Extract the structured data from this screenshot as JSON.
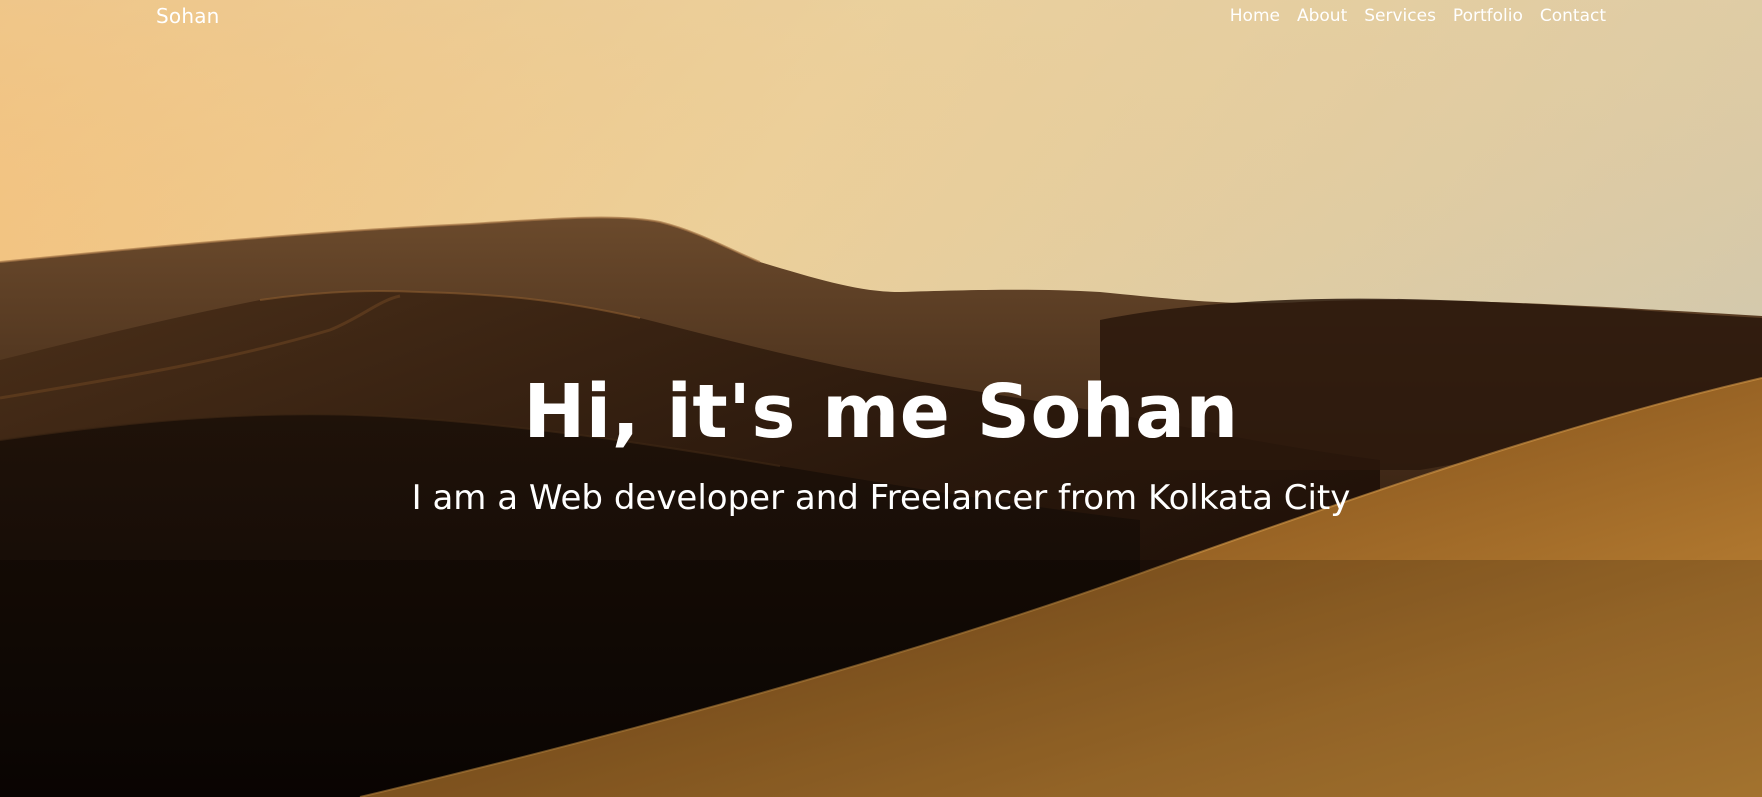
{
  "navbar": {
    "brand": "Sohan",
    "links": [
      {
        "label": "Home"
      },
      {
        "label": "About"
      },
      {
        "label": "Services"
      },
      {
        "label": "Portfolio"
      },
      {
        "label": "Contact"
      }
    ]
  },
  "hero": {
    "title": "Hi, it's me Sohan",
    "subtitle": "I am a Web developer and Freelancer from Kolkata City"
  },
  "colors": {
    "text": "#ffffff",
    "sky_top": "#f4c27e",
    "sky_right": "#d6c8a9",
    "dune_dark": "#120804",
    "dune_lit": "#b8782a"
  }
}
